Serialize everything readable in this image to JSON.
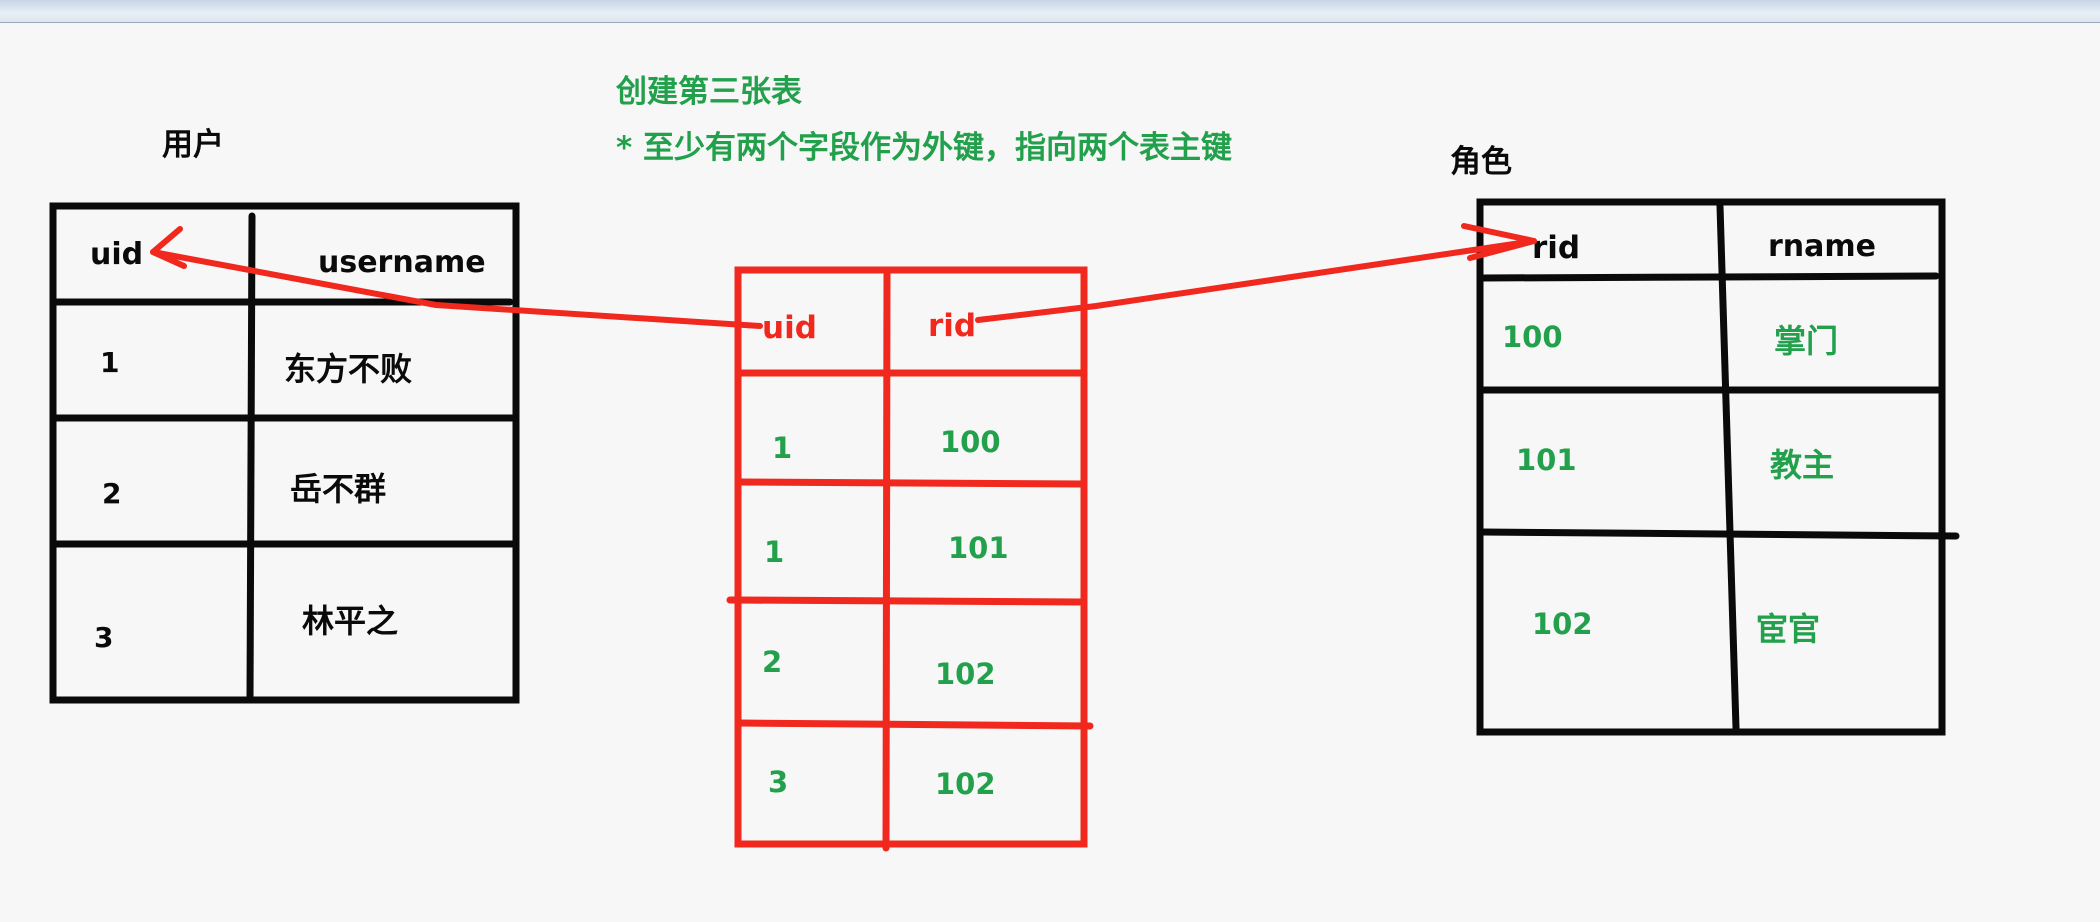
{
  "colors": {
    "black": "#0a0a0a",
    "red": "#f0281e",
    "green": "#22a04b"
  },
  "annotation": {
    "title": "创建第三张表",
    "note": "* 至少有两个字段作为外键，指向两个表主键"
  },
  "user_table": {
    "caption": "用户",
    "headers": [
      "uid",
      "username"
    ],
    "rows": [
      [
        "1",
        "东方不败"
      ],
      [
        "2",
        "岳不群"
      ],
      [
        "3",
        "林平之"
      ]
    ]
  },
  "link_table": {
    "headers": [
      "uid",
      "rid"
    ],
    "rows": [
      [
        "1",
        "100"
      ],
      [
        "1",
        "101"
      ],
      [
        "2",
        "102"
      ],
      [
        "3",
        "102"
      ]
    ]
  },
  "role_table": {
    "caption": "角色",
    "headers": [
      "rid",
      "rname"
    ],
    "rows": [
      [
        "100",
        "掌门"
      ],
      [
        "101",
        "教主"
      ],
      [
        "102",
        "宦官"
      ]
    ]
  }
}
